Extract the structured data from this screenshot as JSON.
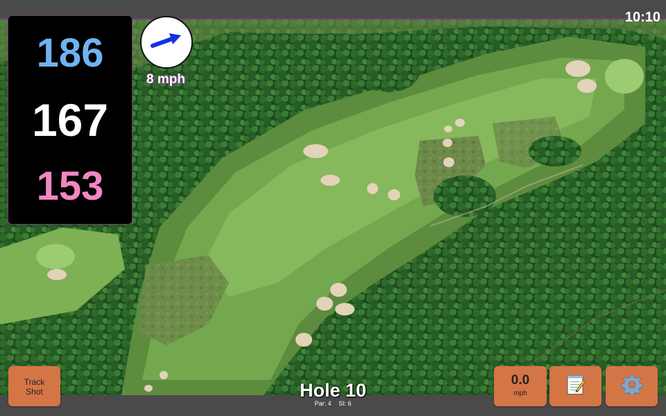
{
  "status": {
    "time": "10:10"
  },
  "yardages": {
    "back": "186",
    "center": "167",
    "front": "153"
  },
  "wind": {
    "speed_label": "8 mph",
    "direction_icon": "wind-arrow-icon"
  },
  "hole": {
    "title": "Hole 10",
    "par_label": "Par: 4",
    "si_label": "SI: 6"
  },
  "buttons": {
    "track_shot_line1": "Track",
    "track_shot_line2": "Shot",
    "speed_value": "0.0",
    "speed_unit": "mph",
    "notes_icon": "notepad-icon",
    "settings_icon": "gear-icon"
  },
  "colors": {
    "back_yardage": "#6fb3f0",
    "center_yardage": "#ffffff",
    "front_yardage": "#f386c3",
    "button_bg": "#d47546",
    "accent": "#7a3b7a"
  }
}
